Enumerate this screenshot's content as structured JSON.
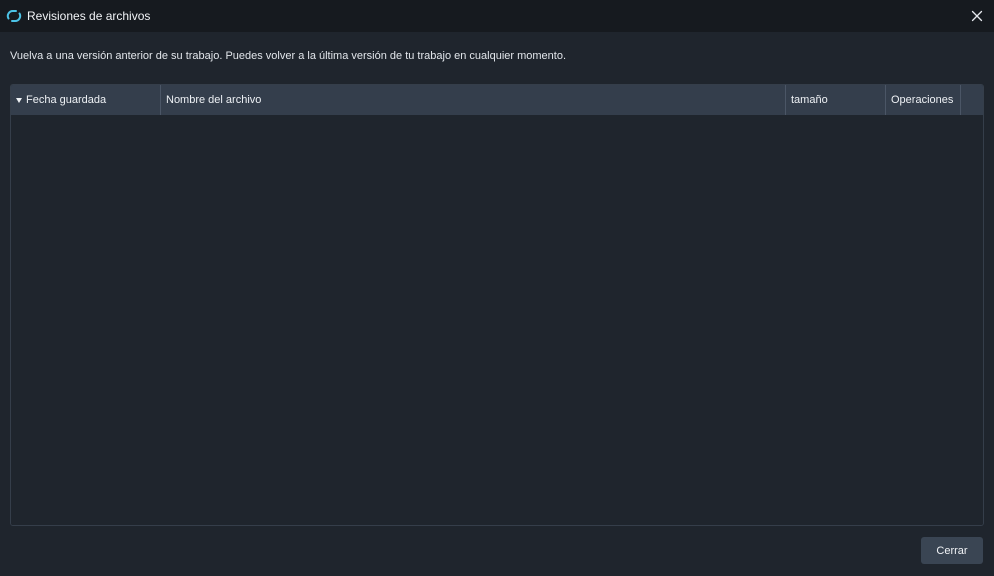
{
  "window": {
    "title": "Revisiones de archivos",
    "app_icon": "sync-logo-icon",
    "close_icon": "close-icon"
  },
  "description": "Vuelva a una versión anterior de su trabajo. Puedes volver a la última versión de tu trabajo en cualquier momento.",
  "table": {
    "columns": [
      {
        "label": "Fecha guardada",
        "sorted": "descending"
      },
      {
        "label": "Nombre del archivo"
      },
      {
        "label": "tamaño"
      },
      {
        "label": "Operaciones"
      },
      {
        "label": ""
      }
    ],
    "rows": []
  },
  "footer": {
    "close_label": "Cerrar"
  },
  "colors": {
    "background": "#1f252d",
    "titlebar": "#161a1f",
    "header": "#343e4c",
    "button": "#3a4553",
    "accent": "#4cc3e6"
  }
}
